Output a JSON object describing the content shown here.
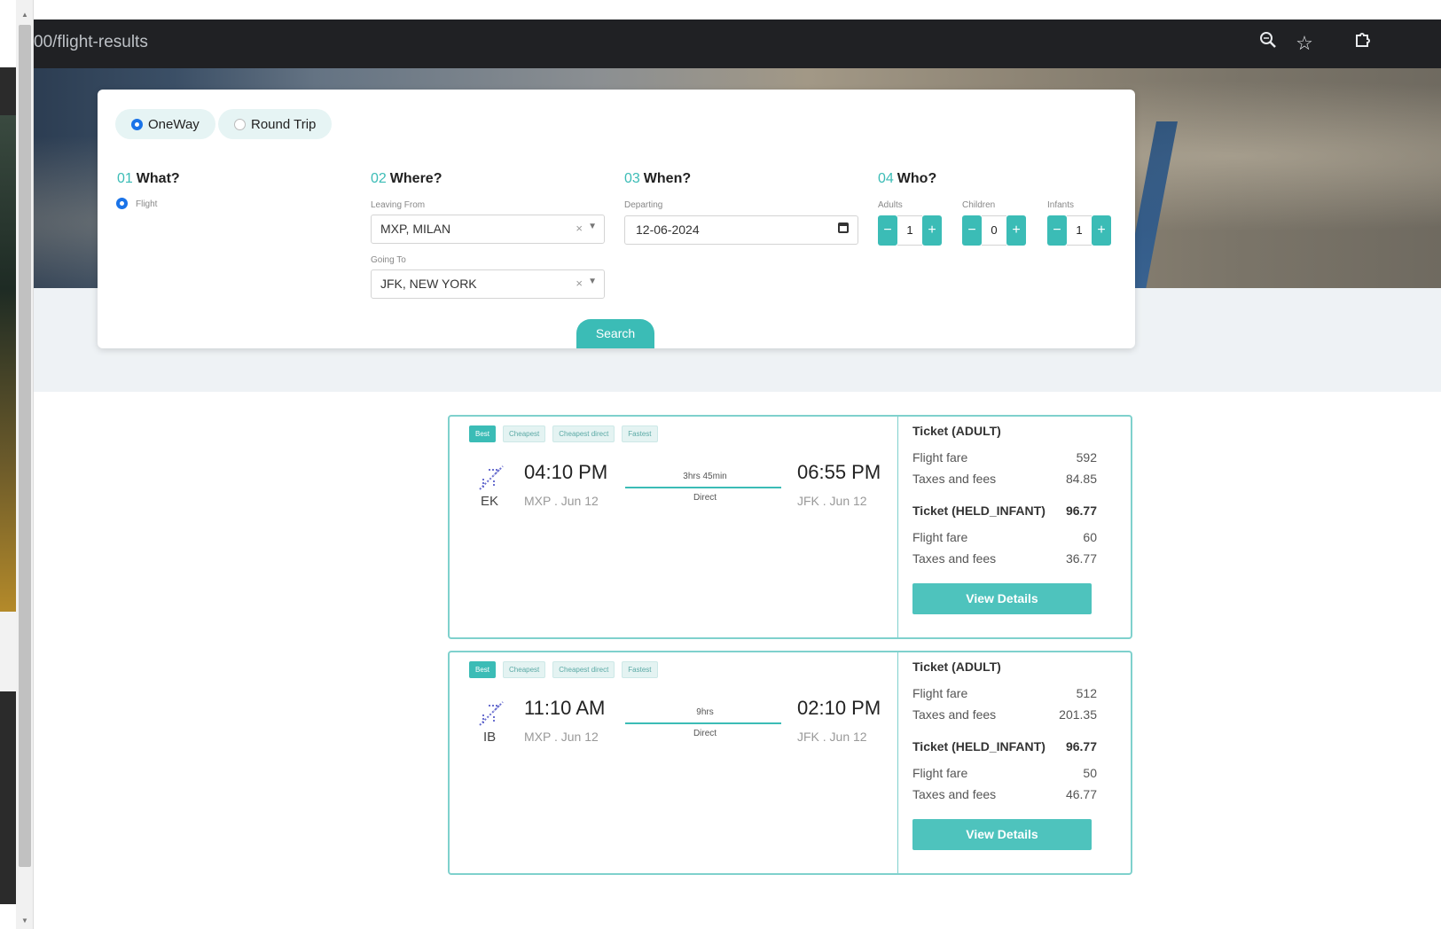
{
  "browser": {
    "url": "00/flight-results",
    "icons": [
      "zoom-icon",
      "star-icon",
      "extension-icon"
    ]
  },
  "search": {
    "trip_types": [
      {
        "label": "OneWay",
        "selected": true
      },
      {
        "label": "Round Trip",
        "selected": false
      }
    ],
    "steps": {
      "what": {
        "num": "01",
        "title": "What?",
        "option": "Flight"
      },
      "where": {
        "num": "02",
        "title": "Where?",
        "leaving_label": "Leaving From",
        "leaving_value": "MXP, MILAN",
        "going_label": "Going To",
        "going_value": "JFK, NEW YORK"
      },
      "when": {
        "num": "03",
        "title": "When?",
        "departing_label": "Departing",
        "departing_value": "12-06-2024"
      },
      "who": {
        "num": "04",
        "title": "Who?",
        "adults_label": "Adults",
        "adults": "1",
        "children_label": "Children",
        "children": "0",
        "infants_label": "Infants",
        "infants": "1"
      }
    },
    "button": "Search"
  },
  "tags": [
    "Best",
    "Cheapest",
    "Cheapest direct",
    "Fastest"
  ],
  "results": [
    {
      "airline": "EK",
      "depart_time": "04:10 PM",
      "depart_place": "MXP . Jun 12",
      "arrive_time": "06:55 PM",
      "arrive_place": "JFK . Jun 12",
      "duration": "3hrs 45min",
      "stops": "Direct",
      "adult_title": "Ticket (ADULT)",
      "adult_fare_label": "Flight fare",
      "adult_fare": "592",
      "adult_tax_label": "Taxes and fees",
      "adult_tax": "84.85",
      "infant_title": "Ticket (HELD_INFANT)",
      "infant_total": "96.77",
      "infant_fare_label": "Flight fare",
      "infant_fare": "60",
      "infant_tax_label": "Taxes and fees",
      "infant_tax": "36.77",
      "button": "View Details"
    },
    {
      "airline": "IB",
      "depart_time": "11:10 AM",
      "depart_place": "MXP . Jun 12",
      "arrive_time": "02:10 PM",
      "arrive_place": "JFK . Jun 12",
      "duration": "9hrs",
      "stops": "Direct",
      "adult_title": "Ticket (ADULT)",
      "adult_fare_label": "Flight fare",
      "adult_fare": "512",
      "adult_tax_label": "Taxes and fees",
      "adult_tax": "201.35",
      "infant_title": "Ticket (HELD_INFANT)",
      "infant_total": "96.77",
      "infant_fare_label": "Flight fare",
      "infant_fare": "50",
      "infant_tax_label": "Taxes and fees",
      "infant_tax": "46.77",
      "button": "View Details"
    }
  ],
  "colors": {
    "accent": "#3bbcb6",
    "browser_bar": "#202124",
    "radio_selected": "#1a73e8"
  }
}
